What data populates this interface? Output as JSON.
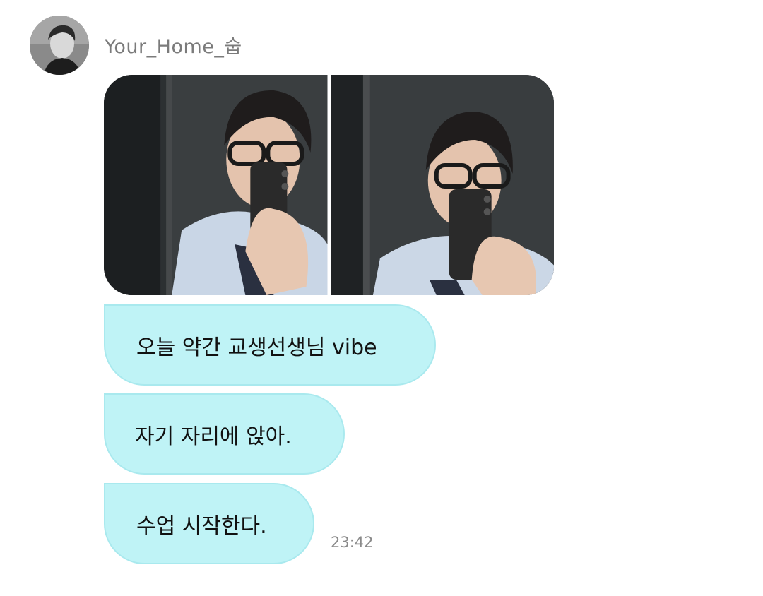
{
  "sender": {
    "name": "Your_Home_숩",
    "avatar_icon": "profile-portrait"
  },
  "photos": [
    {
      "description_icon": "mirror-selfie-photo-left"
    },
    {
      "description_icon": "mirror-selfie-photo-right"
    }
  ],
  "messages": [
    {
      "text": "오늘 약간 교생선생님 vibe"
    },
    {
      "text": "자기 자리에 앉아."
    },
    {
      "text": "수업 시작한다."
    }
  ],
  "timestamp": "23:42",
  "colors": {
    "bubble_bg": "#bff3f6",
    "bubble_border": "#a9e9ee",
    "name_text": "#7b7b7b",
    "timestamp_text": "#8a8a8a"
  }
}
